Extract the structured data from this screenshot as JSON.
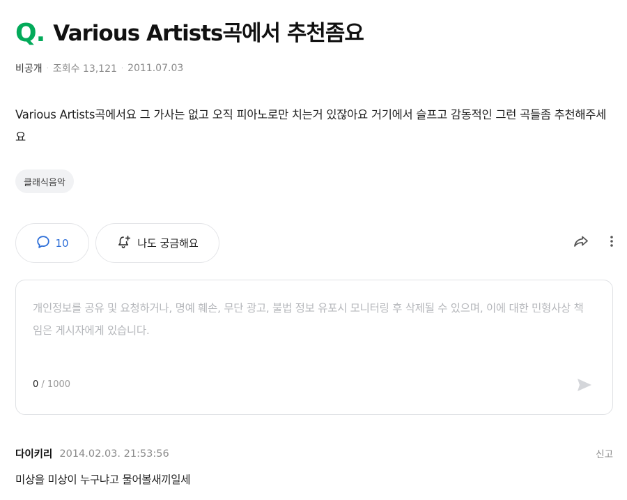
{
  "question": {
    "mark": "Q.",
    "title": "Various Artists곡에서 추천좀요",
    "author": "비공개",
    "views_label": "조회수 13,121",
    "date": "2011.07.03",
    "body": "Various Artists곡에서요 그 가사는 없고 오직 피아노로만 치는거 있잖아요 거기에서 슬프고 감동적인 그런 곡들좀 추천해주세요",
    "tag": "클래식음악"
  },
  "actions": {
    "comment_count": "10",
    "curious_label": "나도 궁금해요",
    "icons": [
      "comment-icon",
      "bell-plus-icon",
      "share-icon",
      "more-vertical-icon"
    ]
  },
  "comment_input": {
    "placeholder": "개인정보를 공유 및 요청하거나, 명예 훼손, 무단 광고, 불법 정보 유포시 모니터링 후 삭제될 수 있으며, 이에 대한 민형사상 책임은 게시자에게 있습니다.",
    "value": "",
    "count_current": "0",
    "count_max": "/ 1000",
    "send_icon": "send-icon"
  },
  "reply": {
    "author": "다이키리",
    "date": "2014.02.03. 21:53:56",
    "report_label": "신고",
    "text": "미상을 미상이 누구냐고 물어볼새끼일세"
  },
  "colors": {
    "accent_green": "#03aa5a",
    "accent_blue": "#2e6fd8"
  }
}
